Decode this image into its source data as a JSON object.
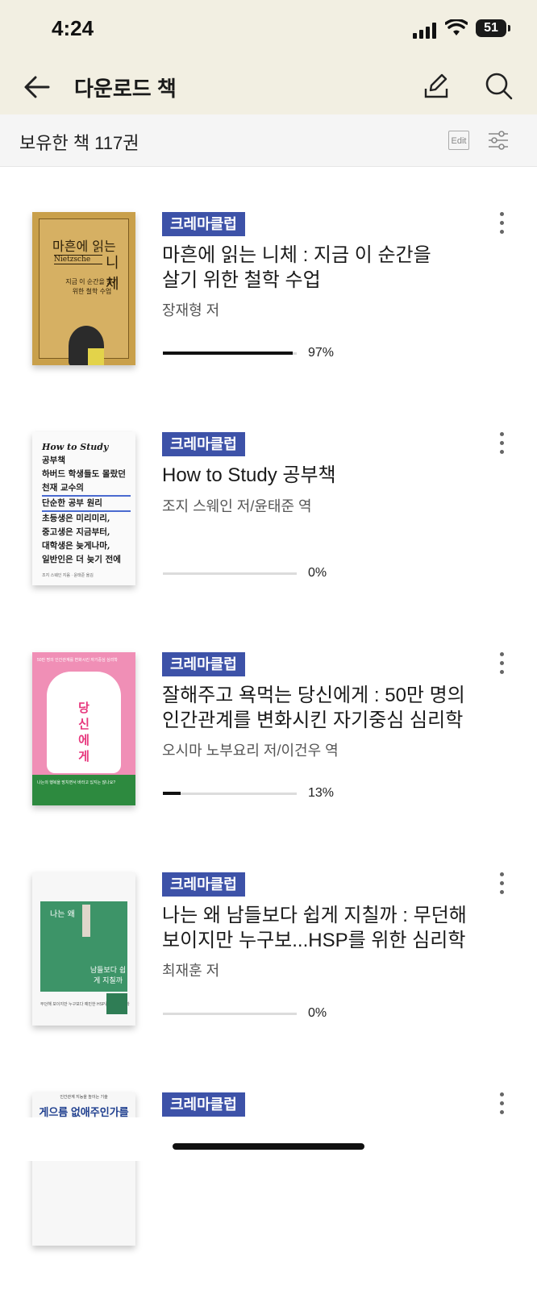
{
  "status": {
    "time": "4:24",
    "battery": "51"
  },
  "nav": {
    "title": "다운로드 책"
  },
  "library": {
    "count_label": "보유한 책 117권",
    "edit_label": "Edit"
  },
  "books": [
    {
      "badge": "크레마클럽",
      "title_lines": [
        "마흔에 읽는 니체 : 지금 이 순간을",
        "살기 위한 철학 수업"
      ],
      "author": "장재형 저",
      "progress": 97,
      "progress_text": "97%",
      "cover": {
        "title_top": "마흔에 읽는",
        "subtitle": "Nietzsche",
        "title_right": "니체",
        "desc": "지금 이 순간을 살기 위한 철학 수업"
      }
    },
    {
      "badge": "크레마클럽",
      "title_lines": [
        "How to Study 공부책"
      ],
      "author": "조지 스웨인 저/윤태준 역",
      "progress": 0,
      "progress_text": "0%",
      "cover": {
        "lines": [
          "How to Study",
          "공부책",
          "하버드 학생들도 몰랐던",
          "천재 교수의",
          "단순한 공부 원리",
          "초등생은 미리미리,",
          "중고생은 지금부터,",
          "대학생은 늦게나마,",
          "일반인은 더 늦기 전에"
        ],
        "foot": "조지 스웨인 지음 · 윤태준 옮김"
      }
    },
    {
      "badge": "크레마클럽",
      "title_lines": [
        "잘해주고 욕먹는 당신에게 : 50만 명의",
        "인간관계를 변화시킨 자기중심 심리학"
      ],
      "author": "오시마 노부요리 저/이건우 역",
      "progress": 13,
      "progress_text": "13%",
      "cover": {
        "top": "50만 명의 인간관계를 변화시킨 자기중심 심리학",
        "vertical": "당신에게",
        "green_text": "나는의 행복을 망치면서 바라고 있지는 않나요?"
      }
    },
    {
      "badge": "크레마클럽",
      "title_lines": [
        "나는 왜 남들보다 쉽게 지칠까 : 무던해",
        "보이지만 누구보...HSP를 위한 심리학"
      ],
      "author": "최재훈 저",
      "progress": 0,
      "progress_text": "0%",
      "cover": {
        "title_left": "나는 왜",
        "title_right": "남들보다 쉽게 지칠까",
        "foot": "무던해 보이지만 누구보다 예민한 HSP를 위한 심리학"
      }
    },
    {
      "badge": "크레마클럽",
      "cover": {
        "head": "인간관계 지능을 높이는 기술",
        "big": "게으름 없애주인가를"
      }
    }
  ]
}
